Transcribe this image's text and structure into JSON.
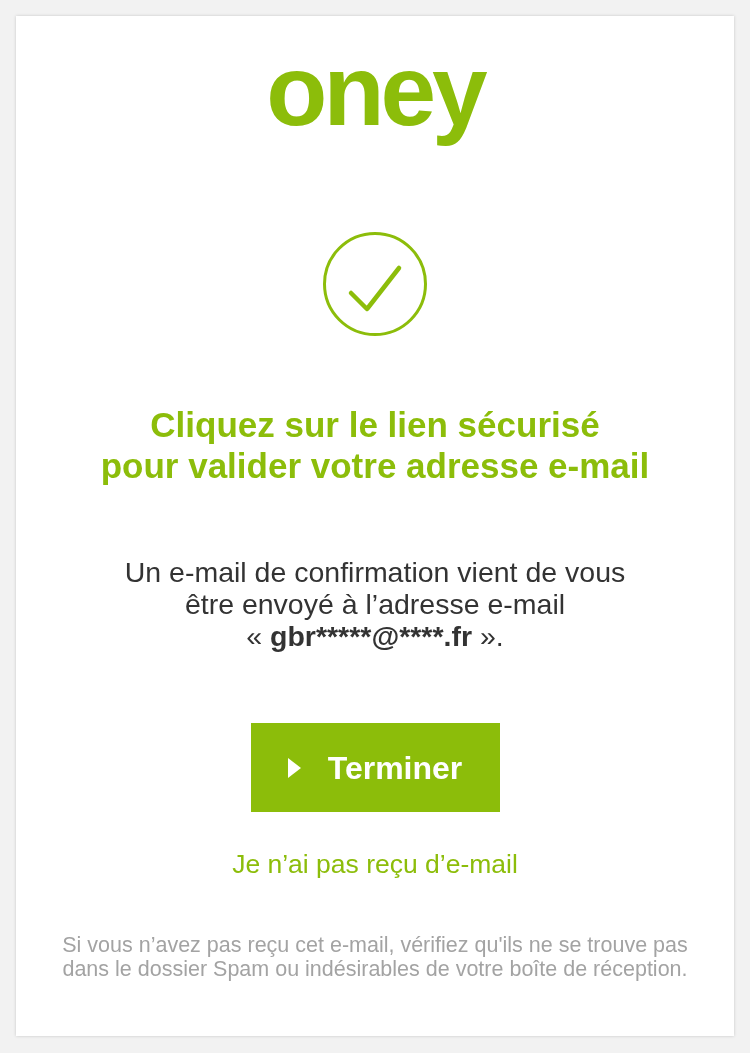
{
  "logo": {
    "text": "oney"
  },
  "heading": "Cliquez sur le lien sécurisé\npour valider votre adresse e-mail",
  "message": {
    "before": "Un e-mail de confirmation vient de vous\nêtre envoyé à l’adresse e-mail\n« ",
    "email": "gbr*****@****.fr",
    "after": " »."
  },
  "button": {
    "label": "Terminer"
  },
  "link": "Je n’ai pas reçu d’e-mail",
  "note": "Si vous n’avez pas reçu cet e-mail, vérifiez qu'ils ne se trouve pas\ndans le dossier Spam ou indésirables de votre boîte de réception."
}
